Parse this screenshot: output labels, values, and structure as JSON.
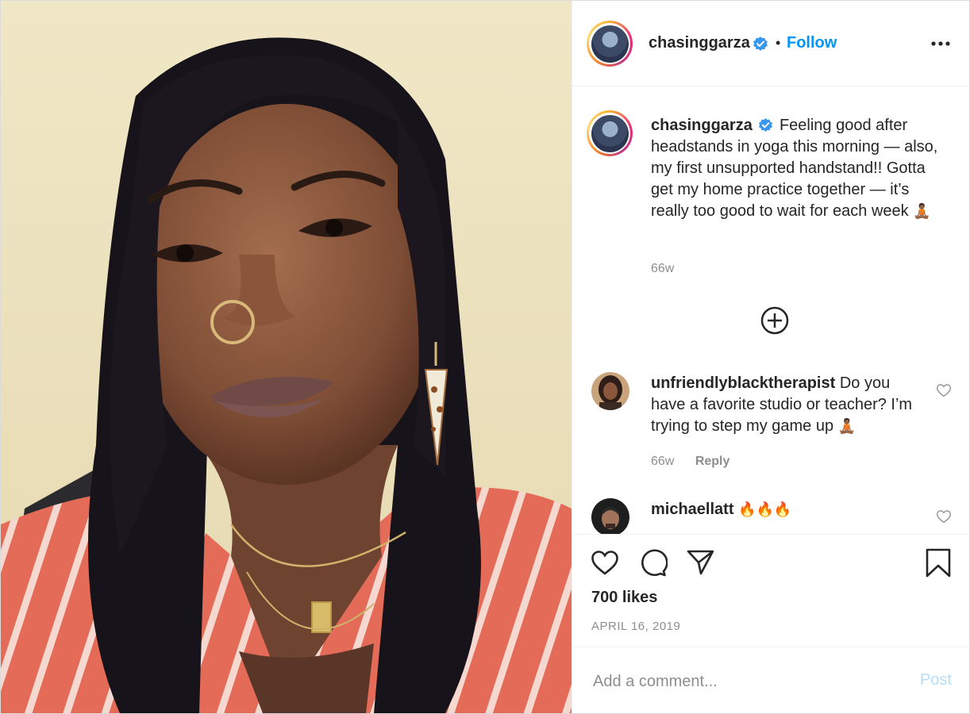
{
  "post": {
    "author": "chasinggarza",
    "follow_label": "Follow",
    "dot": "•",
    "more_icon": "more-options-icon"
  },
  "caption": {
    "username": "chasinggarza",
    "text": "Feeling good after headstands in yoga this morning — also, my first unsupported handstand!! Gotta get my home practice together — it’s really too good to wait for each week",
    "emoji": "🧘🏾",
    "time": "66w"
  },
  "load_more_icon": "plus-circle-icon",
  "comments": [
    {
      "username": "unfriendlyblacktherapist",
      "text": "Do you have a favorite studio or teacher? I’m trying to step my game up",
      "emoji": "🧘🏾",
      "time": "66w",
      "reply_label": "Reply"
    },
    {
      "username": "michaellatt",
      "text": "🔥🔥🔥"
    }
  ],
  "likes": "700 likes",
  "date": "APRIL 16, 2019",
  "add_comment": {
    "placeholder": "Add a comment...",
    "post_label": "Post"
  },
  "colors": {
    "link_blue": "#0095f6",
    "verified_blue": "#3897f0",
    "muted": "#8e8e8e",
    "text": "#262626"
  }
}
